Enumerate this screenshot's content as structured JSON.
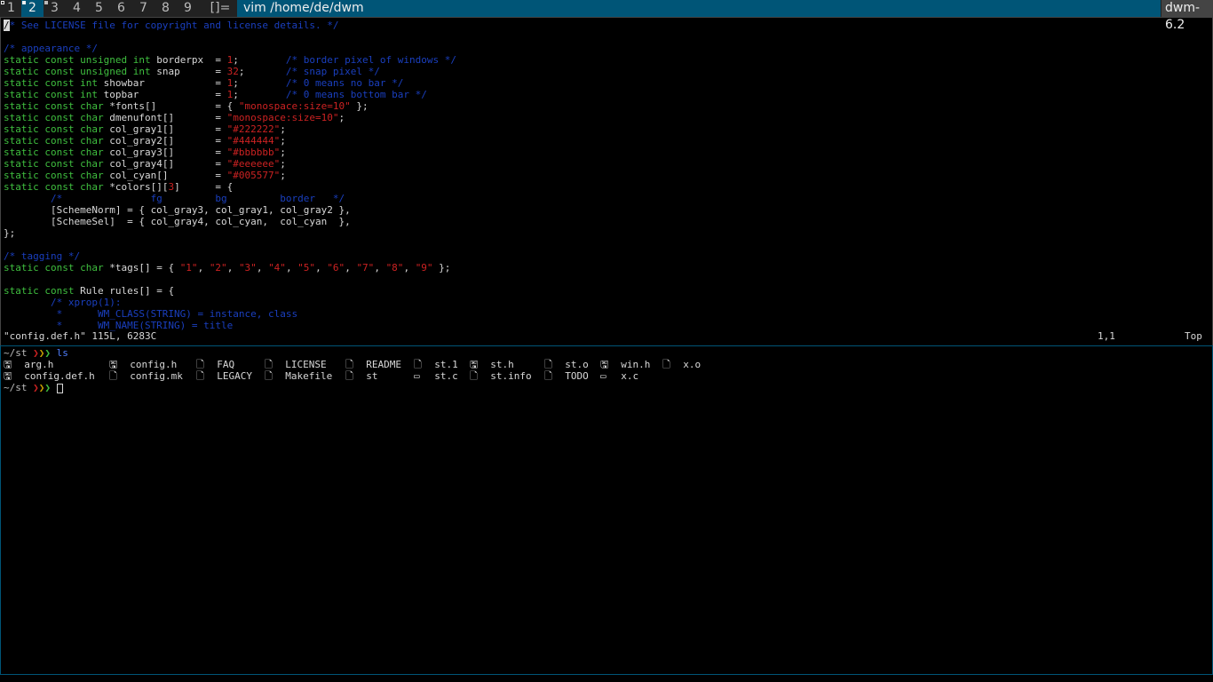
{
  "bar": {
    "tags": [
      "1",
      "2",
      "3",
      "4",
      "5",
      "6",
      "7",
      "8",
      "9"
    ],
    "selected_tag": "2",
    "layout": "[]=",
    "window_title": "vim /home/de/dwm",
    "status": "dwm-6.2"
  },
  "vim": {
    "l1": "/* See LICENSE file for copyright and license details. */",
    "l3": "/* appearance */",
    "l4a": "static const unsigned int",
    "l4b": " borderpx  = ",
    "l4c": "1",
    "l4d": ";        ",
    "l4e": "/* border pixel of windows */",
    "l5a": "static const unsigned int",
    "l5b": " snap      = ",
    "l5c": "32",
    "l5d": ";       ",
    "l5e": "/* snap pixel */",
    "l6a": "static const int",
    "l6b": " showbar            = ",
    "l6c": "1",
    "l6d": ";        ",
    "l6e": "/* 0 means no bar */",
    "l7a": "static const int",
    "l7b": " topbar             = ",
    "l7c": "1",
    "l7d": ";        ",
    "l7e": "/* 0 means bottom bar */",
    "l8a": "static const char",
    "l8b": " *fonts[]          = { ",
    "l8c": "\"monospace:size=10\"",
    "l8d": " };",
    "l9a": "static const char",
    "l9b": " dmenufont[]       = ",
    "l9c": "\"monospace:size=10\"",
    "l9d": ";",
    "l10a": "static const char",
    "l10b": " col_gray1[]       = ",
    "l10c": "\"#222222\"",
    "l10d": ";",
    "l11a": "static const char",
    "l11b": " col_gray2[]       = ",
    "l11c": "\"#444444\"",
    "l11d": ";",
    "l12a": "static const char",
    "l12b": " col_gray3[]       = ",
    "l12c": "\"#bbbbbb\"",
    "l12d": ";",
    "l13a": "static const char",
    "l13b": " col_gray4[]       = ",
    "l13c": "\"#eeeeee\"",
    "l13d": ";",
    "l14a": "static const char",
    "l14b": " col_cyan[]        = ",
    "l14c": "\"#005577\"",
    "l14d": ";",
    "l15a": "static const char",
    "l15b": " *colors[][",
    "l15c": "3",
    "l15d": "]      = {",
    "l16": "        /*               fg         bg         border   */",
    "l17": "        [SchemeNorm] = { col_gray3, col_gray1, col_gray2 },",
    "l18": "        [SchemeSel]  = { col_gray4, col_cyan,  col_cyan  },",
    "l19": "};",
    "l21": "/* tagging */",
    "l22a": "static const char",
    "l22b": " *tags[] = { ",
    "l22c": "\"1\"",
    "l22d": ", ",
    "l22e": "\"2\"",
    "l22f": "\"3\"",
    "l22g": "\"4\"",
    "l22h": "\"5\"",
    "l22i": "\"6\"",
    "l22j": "\"7\"",
    "l22k": "\"8\"",
    "l22l": "\"9\"",
    "l22m": " };",
    "l24a": "static const",
    "l24b": " Rule rules[] = {",
    "l25": "        /* xprop(1):",
    "l26": "         *      WM_CLASS(STRING) = instance, class",
    "l27": "         *      WM_NAME(STRING) = title",
    "status_left": "\"config.def.h\" 115L, 6283C",
    "status_pos": "1,1",
    "status_top": "Top"
  },
  "terminal": {
    "prompt_dir": "~/st",
    "prompt_arrows": [
      "❯",
      "❯",
      "❯"
    ],
    "command": "ls",
    "files_row1": [
      "arg.h",
      "config.h",
      "FAQ",
      "LICENSE",
      "README",
      "st.1",
      "st.h",
      "st.o",
      "win.h",
      "x.o"
    ],
    "files_row2": [
      "config.def.h",
      "config.mk",
      "LEGACY",
      "Makefile",
      "st",
      "st.c",
      "st.info",
      "TODO",
      "x.c"
    ]
  }
}
